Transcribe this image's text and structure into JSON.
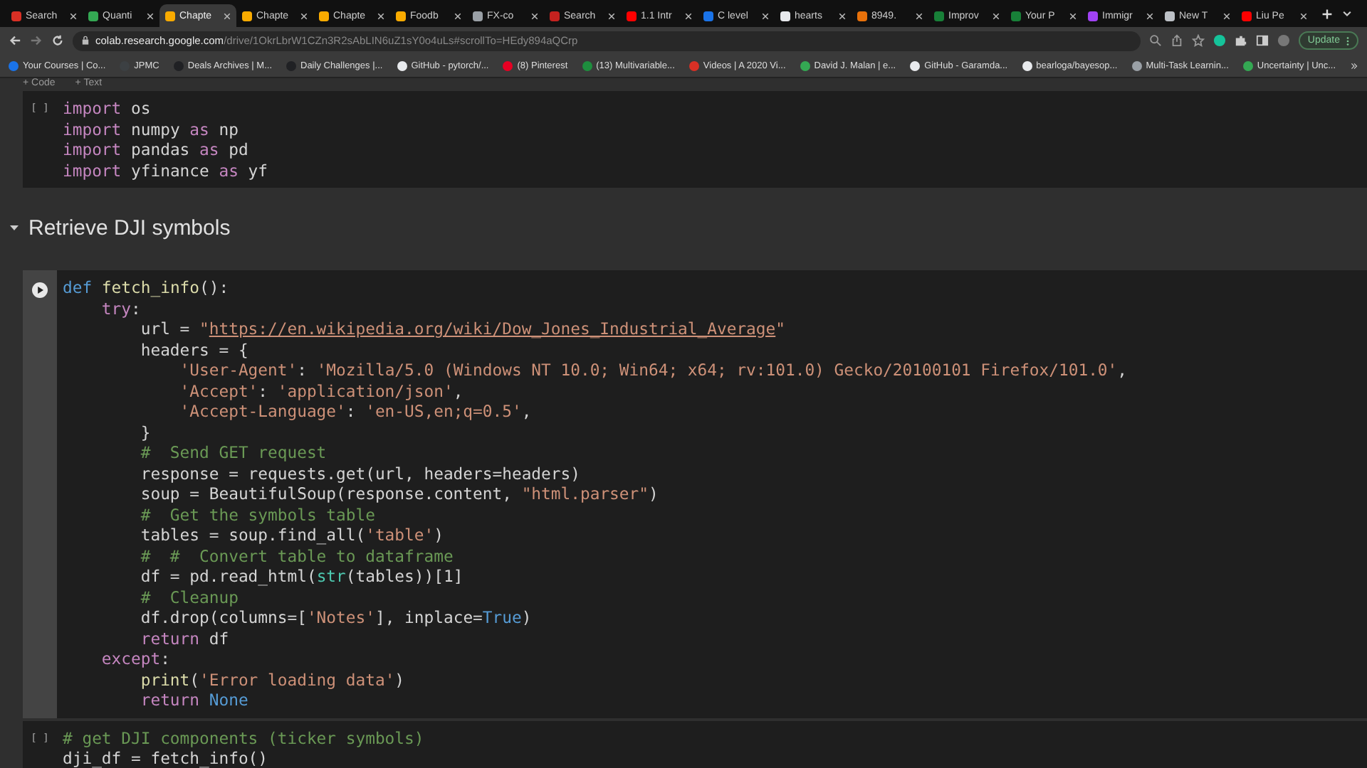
{
  "tabs": [
    {
      "label": "Search",
      "color": "#d93025",
      "selected": false
    },
    {
      "label": "Quanti",
      "color": "#34a853",
      "selected": false
    },
    {
      "label": "Chapte",
      "color": "#f9ab00",
      "selected": true
    },
    {
      "label": "Chapte",
      "color": "#f9ab00",
      "selected": false
    },
    {
      "label": "Chapte",
      "color": "#f9ab00",
      "selected": false
    },
    {
      "label": "Foodb",
      "color": "#f9ab00",
      "selected": false
    },
    {
      "label": "FX-co",
      "color": "#9aa0a6",
      "selected": false
    },
    {
      "label": "Search",
      "color": "#c5221f",
      "selected": false
    },
    {
      "label": "1.1 Intr",
      "color": "#ff0000",
      "selected": false
    },
    {
      "label": "C level",
      "color": "#1a73e8",
      "selected": false
    },
    {
      "label": "hearts",
      "color": "#e8eaed",
      "selected": false
    },
    {
      "label": "8949.",
      "color": "#e8710a",
      "selected": false
    },
    {
      "label": "Improv",
      "color": "#188038",
      "selected": false
    },
    {
      "label": "Your P",
      "color": "#188038",
      "selected": false
    },
    {
      "label": "Immigr",
      "color": "#a142f4",
      "selected": false
    },
    {
      "label": "New T",
      "color": "#bdc1c6",
      "selected": false
    },
    {
      "label": "Liu Pe",
      "color": "#ff0000",
      "selected": false
    }
  ],
  "address_bar": {
    "domain": "colab.research.google.com",
    "path": "/drive/1OkrLbrW1CZn3R2sAbLIN6uZ1sY0o4uLs#scrollTo=HEdy894aQCrp"
  },
  "update_button": "Update",
  "bookmarks": [
    {
      "label": "Your Courses | Co...",
      "color": "#1a73e8"
    },
    {
      "label": "JPMC",
      "color": "#3c4043"
    },
    {
      "label": "Deals Archives | M...",
      "color": "#202124"
    },
    {
      "label": "Daily Challenges |...",
      "color": "#202124"
    },
    {
      "label": "GitHub - pytorch/...",
      "color": "#e8eaed"
    },
    {
      "label": "(8) Pinterest",
      "color": "#e60023"
    },
    {
      "label": "(13) Multivariable...",
      "color": "#1e8e3e"
    },
    {
      "label": "Videos | A 2020 Vi...",
      "color": "#d93025"
    },
    {
      "label": "David J. Malan | e...",
      "color": "#34a853"
    },
    {
      "label": "GitHub - Garamda...",
      "color": "#e8eaed"
    },
    {
      "label": "bearloga/bayesop...",
      "color": "#e8eaed"
    },
    {
      "label": "Multi-Task Learnin...",
      "color": "#9aa0a6"
    },
    {
      "label": "Uncertainty | Unc...",
      "color": "#34a853"
    }
  ],
  "notebook_toolbar": [
    "+ Code",
    "+ Text"
  ],
  "sections": [
    {
      "kind": "code",
      "run_button": false,
      "execution_count": "[ ]",
      "focused": false,
      "lines": [
        [
          {
            "kind": "keyword",
            "text": "import"
          },
          {
            "kind": "plain",
            "text": " os"
          }
        ],
        [
          {
            "kind": "keyword",
            "text": "import"
          },
          {
            "kind": "plain",
            "text": " numpy "
          },
          {
            "kind": "keyword",
            "text": "as"
          },
          {
            "kind": "plain",
            "text": " np"
          }
        ],
        [
          {
            "kind": "keyword",
            "text": "import"
          },
          {
            "kind": "plain",
            "text": " pandas "
          },
          {
            "kind": "keyword",
            "text": "as"
          },
          {
            "kind": "plain",
            "text": " pd"
          }
        ],
        [
          {
            "kind": "keyword",
            "text": "import"
          },
          {
            "kind": "plain",
            "text": " yfinance "
          },
          {
            "kind": "keyword",
            "text": "as"
          },
          {
            "kind": "plain",
            "text": " yf"
          }
        ]
      ]
    },
    {
      "kind": "heading",
      "text": "Retrieve DJI symbols",
      "expanded": true
    },
    {
      "kind": "code",
      "run_button": true,
      "focused": true,
      "lines": [
        [
          {
            "kind": "define",
            "text": "def"
          },
          {
            "kind": "function",
            "text": " fetch_info"
          },
          {
            "kind": "plain",
            "text": "():"
          }
        ],
        [
          {
            "kind": "keyword",
            "text": "    try"
          },
          {
            "kind": "plain",
            "text": ":"
          }
        ],
        [
          {
            "kind": "plain",
            "text": "        url = "
          },
          {
            "kind": "string",
            "text": "\""
          },
          {
            "kind": "link",
            "text": "https://en.wikipedia.org/wiki/Dow_Jones_Industrial_Average"
          },
          {
            "kind": "string",
            "text": "\""
          }
        ],
        [
          {
            "kind": "plain",
            "text": "        headers = {"
          }
        ],
        [
          {
            "kind": "string",
            "text": "            'User-Agent'"
          },
          {
            "kind": "plain",
            "text": ": "
          },
          {
            "kind": "string",
            "text": "'Mozilla/5.0 (Windows NT 10.0; Win64; x64; rv:101.0) Gecko/20100101 Firefox/101.0'"
          },
          {
            "kind": "plain",
            "text": ","
          }
        ],
        [
          {
            "kind": "string",
            "text": "            'Accept'"
          },
          {
            "kind": "plain",
            "text": ": "
          },
          {
            "kind": "string",
            "text": "'application/json'"
          },
          {
            "kind": "plain",
            "text": ","
          }
        ],
        [
          {
            "kind": "string",
            "text": "            'Accept-Language'"
          },
          {
            "kind": "plain",
            "text": ": "
          },
          {
            "kind": "string",
            "text": "'en-US,en;q=0.5'"
          },
          {
            "kind": "plain",
            "text": ","
          }
        ],
        [
          {
            "kind": "plain",
            "text": "        }"
          }
        ],
        [
          {
            "kind": "comment",
            "text": "        #  Send GET request"
          }
        ],
        [
          {
            "kind": "plain",
            "text": "        response = requests.get(url, headers=headers)"
          }
        ],
        [
          {
            "kind": "plain",
            "text": "        soup = BeautifulSoup(response.content, "
          },
          {
            "kind": "string",
            "text": "\"html.parser\""
          },
          {
            "kind": "plain",
            "text": ")"
          }
        ],
        [
          {
            "kind": "comment",
            "text": "        #  Get the symbols table"
          }
        ],
        [
          {
            "kind": "plain",
            "text": "        tables = soup.find_all("
          },
          {
            "kind": "string",
            "text": "'table'"
          },
          {
            "kind": "plain",
            "text": ")"
          }
        ],
        [
          {
            "kind": "comment",
            "text": "        #  #  Convert table to dataframe"
          }
        ],
        [
          {
            "kind": "plain",
            "text": "        df = pd.read_html("
          },
          {
            "kind": "builtin",
            "text": "str"
          },
          {
            "kind": "plain",
            "text": "(tables))[1]"
          }
        ],
        [
          {
            "kind": "comment",
            "text": "        #  Cleanup"
          }
        ],
        [
          {
            "kind": "plain",
            "text": "        df.drop(columns=["
          },
          {
            "kind": "string",
            "text": "'Notes'"
          },
          {
            "kind": "plain",
            "text": "], inplace="
          },
          {
            "kind": "constant",
            "text": "True"
          },
          {
            "kind": "plain",
            "text": ")"
          }
        ],
        [
          {
            "kind": "keyword",
            "text": "        return"
          },
          {
            "kind": "plain",
            "text": " df"
          }
        ],
        [
          {
            "kind": "keyword",
            "text": "    except"
          },
          {
            "kind": "plain",
            "text": ":"
          }
        ],
        [
          {
            "kind": "function",
            "text": "        print"
          },
          {
            "kind": "plain",
            "text": "("
          },
          {
            "kind": "string",
            "text": "'Error loading data'"
          },
          {
            "kind": "plain",
            "text": ")"
          }
        ],
        [
          {
            "kind": "keyword",
            "text": "        return"
          },
          {
            "kind": "constant",
            "text": " None"
          }
        ]
      ]
    },
    {
      "kind": "code",
      "run_button": false,
      "execution_count": "[ ]",
      "focused": false,
      "lines": [
        [
          {
            "kind": "comment",
            "text": "# get DJI components (ticker symbols)"
          }
        ],
        [
          {
            "kind": "plain",
            "text": "dji_df = fetch_info()"
          }
        ]
      ]
    }
  ]
}
